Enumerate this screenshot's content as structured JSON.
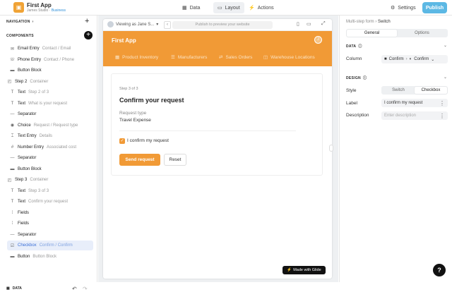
{
  "app": {
    "name": "First App",
    "workspace": "James Studio",
    "plan": "Business"
  },
  "topnav": {
    "data": "Data",
    "layout": "Layout",
    "actions": "Actions",
    "settings": "Settings",
    "publish": "Publish"
  },
  "left": {
    "navigation": "NAVIGATION",
    "components": "COMPONENTS",
    "items": [
      {
        "icon": "email-icon",
        "name": "Email Entry",
        "sub": "Contact / Email"
      },
      {
        "icon": "phone-icon",
        "name": "Phone Entry",
        "sub": "Contact / Phone"
      },
      {
        "icon": "button-icon",
        "name": "Button Block",
        "sub": ""
      },
      {
        "icon": "step-icon",
        "name": "Step 2",
        "sub": "Container"
      },
      {
        "icon": "text-icon",
        "name": "Text",
        "sub": "Step 2 of 3"
      },
      {
        "icon": "text-icon",
        "name": "Text",
        "sub": "What is your request"
      },
      {
        "icon": "separator-icon",
        "name": "Separator",
        "sub": ""
      },
      {
        "icon": "choice-icon",
        "name": "Choice",
        "sub": "Request / Request type"
      },
      {
        "icon": "text-entry-icon",
        "name": "Text Entry",
        "sub": "Details"
      },
      {
        "icon": "number-icon",
        "name": "Number Entry",
        "sub": "Associated cost"
      },
      {
        "icon": "separator-icon",
        "name": "Separator",
        "sub": ""
      },
      {
        "icon": "button-icon",
        "name": "Button Block",
        "sub": ""
      },
      {
        "icon": "step-icon",
        "name": "Step 3",
        "sub": "Container"
      },
      {
        "icon": "text-icon",
        "name": "Text",
        "sub": "Step 3 of 3"
      },
      {
        "icon": "text-icon",
        "name": "Text",
        "sub": "Confirm your request"
      },
      {
        "icon": "fields-icon",
        "name": "Fields",
        "sub": ""
      },
      {
        "icon": "fields-icon",
        "name": "Fields",
        "sub": ""
      },
      {
        "icon": "separator-icon",
        "name": "Separator",
        "sub": ""
      },
      {
        "icon": "checkbox-icon",
        "name": "Checkbox",
        "sub": "Confirm / Confirm"
      },
      {
        "icon": "button-icon",
        "name": "Button",
        "sub": "Button Block"
      }
    ],
    "data_label": "DATA"
  },
  "canvas": {
    "viewing_as": "Viewing as Jane S...",
    "preview_hint": "Publish to preview your website",
    "app_title": "First App",
    "avatar": "J",
    "tabs": [
      "Product Inventory",
      "Manufacturers",
      "Sales Orders",
      "Warehouse Locations"
    ],
    "step_label": "Step 3 of 3",
    "title": "Confirm your request",
    "field_label": "Request type",
    "field_value": "Travel Expense",
    "checkbox_label": "I confirm my request",
    "send": "Send request",
    "reset": "Reset",
    "made_with": "Made with Glide"
  },
  "right": {
    "breadcrumb_parent": "Multi-step form",
    "breadcrumb_current": "Switch",
    "tab_general": "General",
    "tab_options": "Options",
    "data_section": "DATA",
    "column_label": "Column",
    "column_value_1": "Confirm",
    "column_value_2": "Confirm",
    "design_section": "DESIGN",
    "style_label": "Style",
    "style_switch": "Switch",
    "style_checkbox": "Checkbox",
    "label_label": "Label",
    "label_value": "I confirm my request",
    "desc_label": "Description",
    "desc_placeholder": "Enter description"
  },
  "help": "?"
}
